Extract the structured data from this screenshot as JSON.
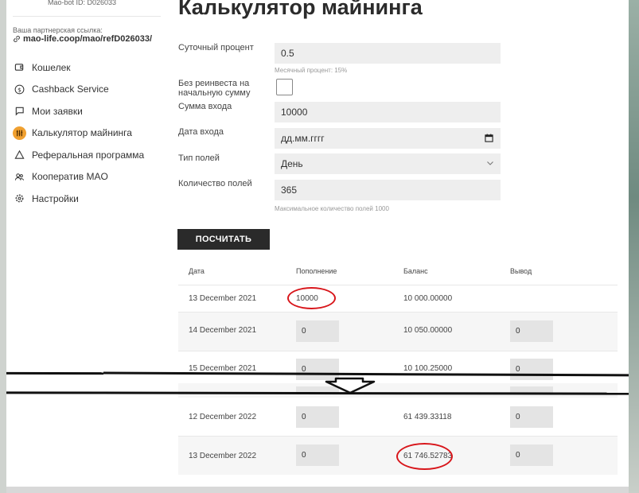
{
  "sidebar": {
    "user_id": "Mao-bot ID: D026033",
    "ref_label": "Ваша партнерская ссылка:",
    "ref_link": "mao-life.coop/mao/refD026033/",
    "items": [
      {
        "label": "Кошелек",
        "icon": "wallet-icon"
      },
      {
        "label": "Cashback Service",
        "icon": "dollar-icon"
      },
      {
        "label": "Мои заявки",
        "icon": "chat-icon"
      },
      {
        "label": "Калькулятор майнинга",
        "icon": "calculator-icon",
        "active": true
      },
      {
        "label": "Реферальная программа",
        "icon": "triangle-icon"
      },
      {
        "label": "Кооператив MAO",
        "icon": "users-icon"
      },
      {
        "label": "Настройки",
        "icon": "gear-icon"
      }
    ]
  },
  "main": {
    "title": "Калькулятор майнинга",
    "daily_label": "Суточный процент",
    "daily_value": "0.5",
    "monthly_hint": "Месячный процент: 15%",
    "reinvest_label": "Без реинвеста на начальную сумму",
    "amount_label": "Сумма входа",
    "amount_value": "10000",
    "date_label": "Дата входа",
    "date_placeholder": "дд.мм.гггг",
    "field_type_label": "Тип полей",
    "field_type_value": "День",
    "field_count_label": "Количество полей",
    "field_count_value": "365",
    "max_hint": "Максимальное количество полей 1000",
    "calc_button": "ПОСЧИТАТЬ"
  },
  "table": {
    "headers": [
      "Дата",
      "Пополнение",
      "Баланс",
      "Вывод"
    ],
    "rows": [
      {
        "date": "13 December 2021",
        "deposit": "10000",
        "balance": "10 000.00000",
        "withdraw": ""
      },
      {
        "date": "14 December 2021",
        "deposit": "0",
        "balance": "10 050.00000",
        "withdraw": "0"
      },
      {
        "date": "15 December 2021",
        "deposit": "0",
        "balance": "10 100.25000",
        "withdraw": "0"
      },
      {
        "date": "12 December 2022",
        "deposit": "0",
        "balance": "61 439.33118",
        "withdraw": "0"
      },
      {
        "date": "13 December 2022",
        "deposit": "0",
        "balance": "61 746.52783",
        "withdraw": "0"
      }
    ]
  },
  "colors": {
    "accent": "#f0a030",
    "annotation": "#d8161b",
    "button": "#2a2a2a"
  }
}
